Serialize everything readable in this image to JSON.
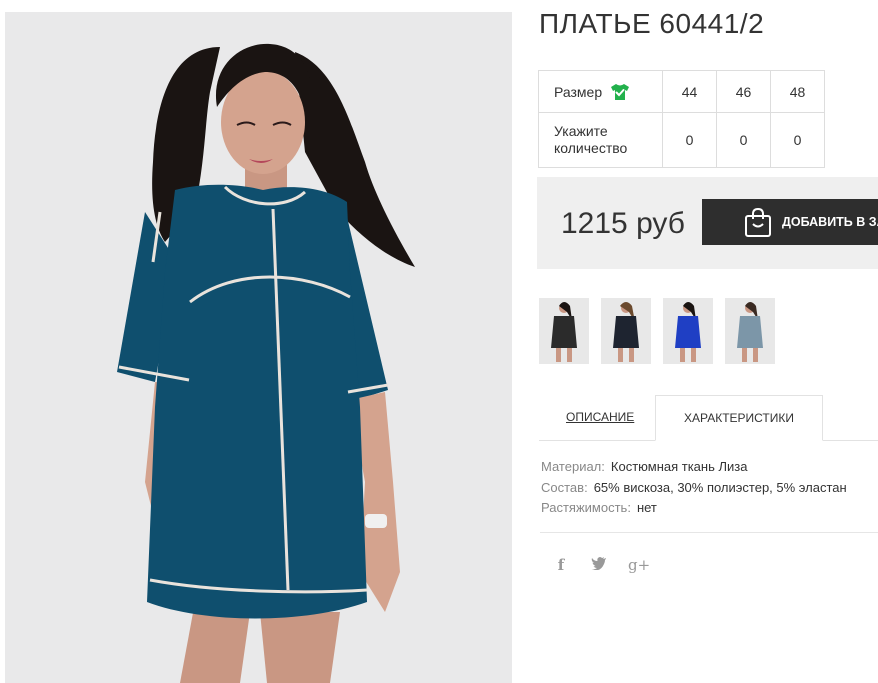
{
  "product": {
    "title": "ПЛАТЬЕ 60441/2"
  },
  "size_table": {
    "size_label": "Размер",
    "size_icon": "tshirt-check-icon",
    "qty_label": "Укажите количество",
    "sizes": [
      "44",
      "46",
      "48"
    ],
    "quantities": [
      "0",
      "0",
      "0"
    ]
  },
  "buy": {
    "price": "1215 руб",
    "add_button": "ДОБАВИТЬ В ЗАКАЗ",
    "button_icon": "shopping-bag-icon"
  },
  "thumbnails": [
    {
      "color_name": "black",
      "color": "#2b2b2b"
    },
    {
      "color_name": "navy",
      "color": "#1e2430"
    },
    {
      "color_name": "blue",
      "color": "#1f3fc4"
    },
    {
      "color_name": "grey-blue",
      "color": "#7c96a8"
    }
  ],
  "tabs": [
    {
      "label": "ОПИСАНИЕ"
    },
    {
      "label": "ХАРАКТЕРИСТИКИ"
    }
  ],
  "specs": [
    {
      "key": "Материал:",
      "value": "Костюмная ткань Лиза"
    },
    {
      "key": "Состав:",
      "value": "65% вискоза, 30% полиэстер, 5% эластан"
    },
    {
      "key": "Растяжимость:",
      "value": "нет"
    }
  ],
  "social": {
    "facebook": "f",
    "twitter": "twitter-bird",
    "googleplus": "g+"
  },
  "colors": {
    "dress": "#0f4f6e",
    "accent_green": "#22b14c",
    "button_bg": "#2e2e2e",
    "buybox_bg": "#efefef"
  }
}
